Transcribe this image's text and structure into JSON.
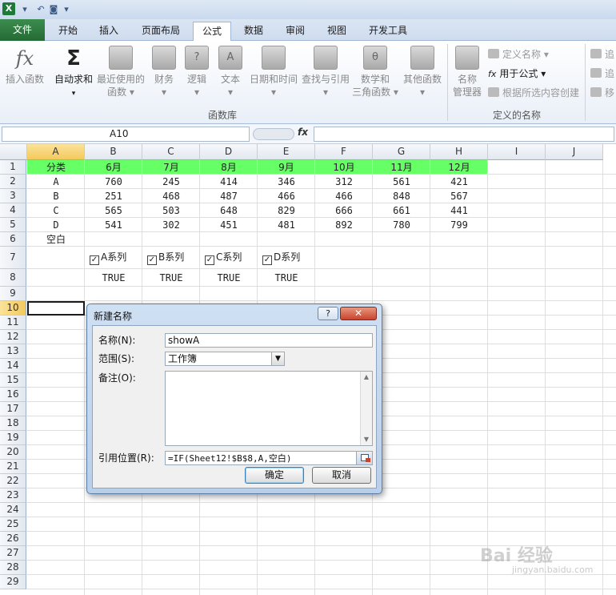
{
  "ribbon_tabs": [
    "文件",
    "开始",
    "插入",
    "页面布局",
    "公式",
    "数据",
    "审阅",
    "视图",
    "开发工具"
  ],
  "ribbon": {
    "insert_function": "插入函数",
    "autosum": "自动求和",
    "recent_line1": "最近使用的",
    "recent_line2": "函数",
    "finance": "财务",
    "logic": "逻辑",
    "text": "文本",
    "datetime": "日期和时间",
    "lookup": "查找与引用",
    "math_line1": "数学和",
    "math_line2": "三角函数",
    "other": "其他函数",
    "name_mgr_line1": "名称",
    "name_mgr_line2": "管理器",
    "define_name": "定义名称",
    "use_in_formula": "用于公式",
    "create_from_sel": "根据所选内容创建",
    "group_function_library": "函数库",
    "group_defined_names": "定义的名称",
    "trace_1": "追",
    "trace_2": "追",
    "trace_3": "移"
  },
  "formula_bar": {
    "name_box": "A10",
    "fx": "fx",
    "formula": ""
  },
  "columns": [
    "A",
    "B",
    "C",
    "D",
    "E",
    "F",
    "G",
    "H",
    "I",
    "J"
  ],
  "rows": [
    "1",
    "2",
    "3",
    "4",
    "5",
    "6",
    "7",
    "8",
    "9",
    "10",
    "11",
    "12",
    "13",
    "14",
    "15",
    "16",
    "17",
    "18",
    "19",
    "20",
    "21",
    "22",
    "23",
    "24",
    "25",
    "26",
    "27",
    "28",
    "29"
  ],
  "sheet": {
    "header": [
      "分类",
      "6月",
      "7月",
      "8月",
      "9月",
      "10月",
      "11月",
      "12月"
    ],
    "data": [
      [
        "A",
        "760",
        "245",
        "414",
        "346",
        "312",
        "561",
        "421"
      ],
      [
        "B",
        "251",
        "468",
        "487",
        "466",
        "466",
        "848",
        "567"
      ],
      [
        "C",
        "565",
        "503",
        "648",
        "829",
        "666",
        "661",
        "441"
      ],
      [
        "D",
        "541",
        "302",
        "451",
        "481",
        "892",
        "780",
        "799"
      ]
    ],
    "blank_label": "空白",
    "checkboxes": [
      "A系列",
      "B系列",
      "C系列",
      "D系列"
    ],
    "bools": [
      "TRUE",
      "TRUE",
      "TRUE",
      "TRUE"
    ]
  },
  "dialog": {
    "title": "新建名称",
    "help": "?",
    "close": "✕",
    "name_label": "名称(N):",
    "name_value": "showA",
    "scope_label": "范围(S):",
    "scope_value": "工作簿",
    "comment_label": "备注(O):",
    "ref_label": "引用位置(R):",
    "ref_value": "=IF(Sheet12!$B$8,A,空白)",
    "ok": "确定",
    "cancel": "取消"
  },
  "watermark": "Bai 经验",
  "watermark_sub": "jingyan.baidu.com"
}
